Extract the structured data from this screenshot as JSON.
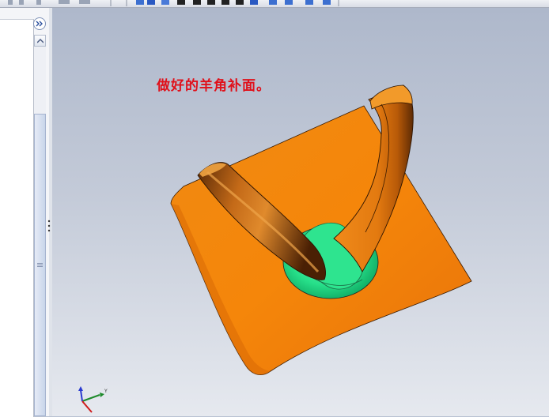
{
  "viewport": {
    "annotation": "做好的羊角补面。",
    "background_top": "#aeb8cb",
    "background_bottom": "#e6e9ef"
  },
  "model": {
    "surface_color": "#f07e0a",
    "horn_color": "#c9650a",
    "fill_color": "#27e08a"
  },
  "triad": {
    "axis_y_label": "Y"
  },
  "icons": [
    "collapse-chevrons-icon",
    "scroll-up-icon",
    "scroll-grip-icon",
    "view-triad-icon"
  ]
}
